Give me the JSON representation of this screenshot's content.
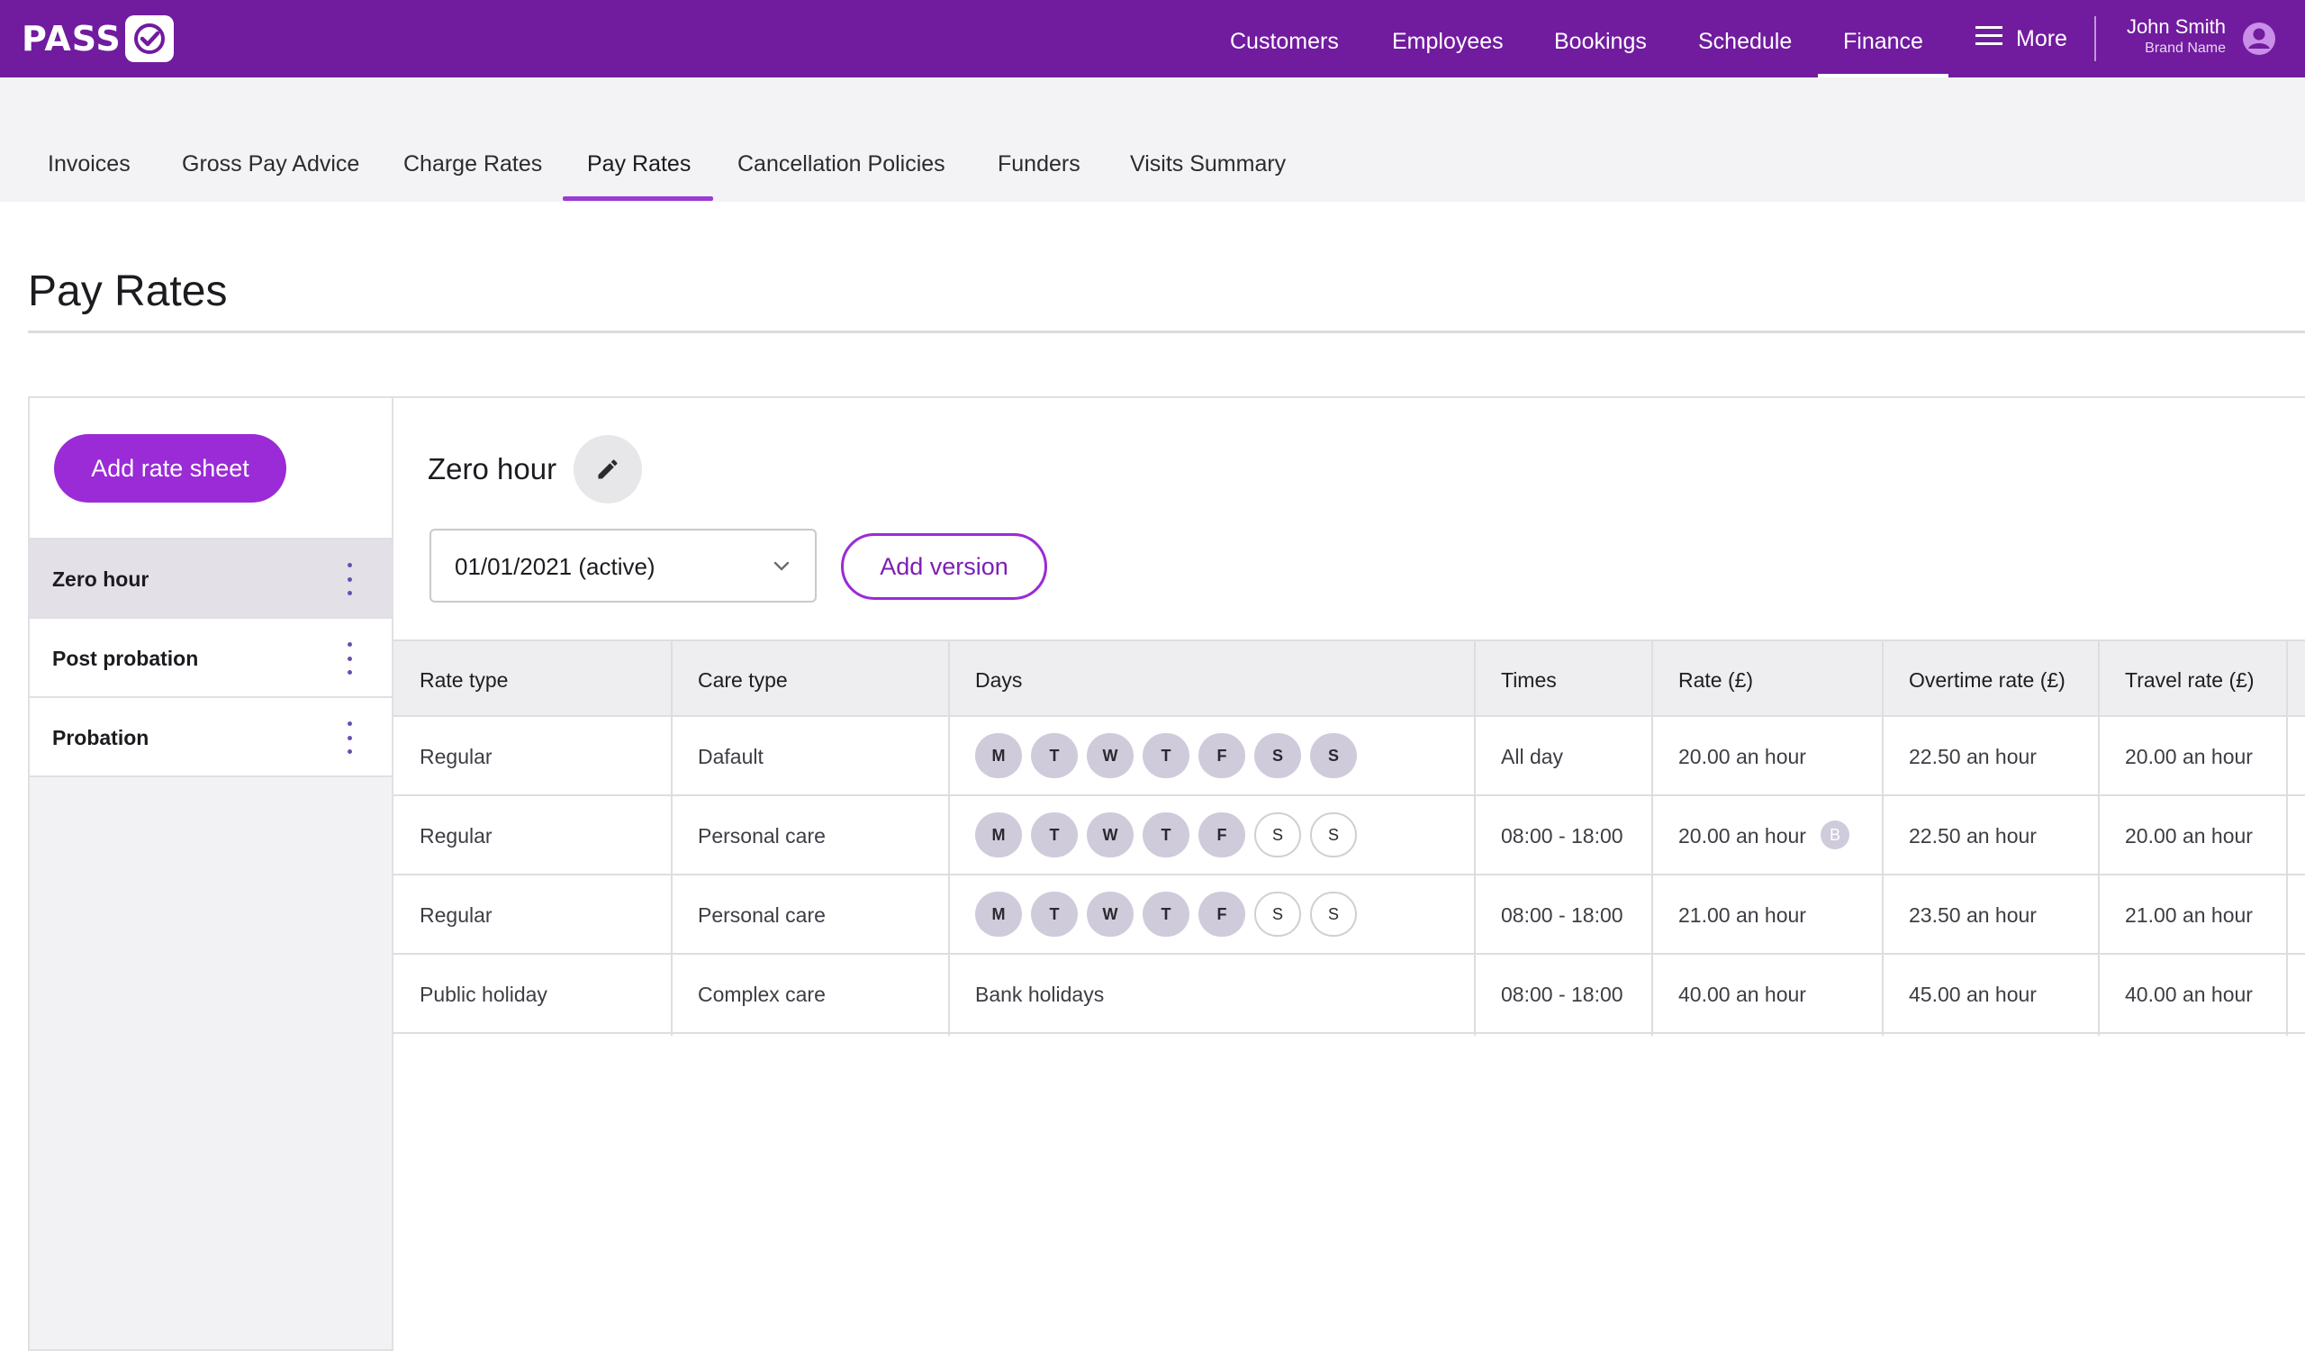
{
  "brand": {
    "logo_text": "PASS",
    "topbar_color": "#711b9f",
    "accent": "#9a2bd6"
  },
  "nav": {
    "items": [
      {
        "label": "Customers"
      },
      {
        "label": "Employees"
      },
      {
        "label": "Bookings"
      },
      {
        "label": "Schedule"
      },
      {
        "label": "Finance",
        "active": true
      }
    ],
    "more_label": "More"
  },
  "user": {
    "name": "John Smith",
    "brand": "Brand Name",
    "icon": "account-circle-icon"
  },
  "subtabs": [
    {
      "label": "Invoices"
    },
    {
      "label": "Gross Pay Advice"
    },
    {
      "label": "Charge Rates"
    },
    {
      "label": "Pay Rates",
      "active": true
    },
    {
      "label": "Cancellation Policies"
    },
    {
      "label": "Funders"
    },
    {
      "label": "Visits Summary"
    }
  ],
  "page": {
    "title": "Pay Rates"
  },
  "sidebar": {
    "add_button": "Add rate sheet",
    "sheets": [
      {
        "label": "Zero hour",
        "active": true
      },
      {
        "label": "Post probation"
      },
      {
        "label": "Probation"
      }
    ]
  },
  "sheet": {
    "title": "Zero hour",
    "version_value": "01/01/2021 (active)",
    "add_version": "Add version"
  },
  "table": {
    "headers": [
      "Rate type",
      "Care type",
      "Days",
      "Times",
      "Rate (£)",
      "Overtime rate (£)",
      "Travel rate (£)"
    ],
    "rows": [
      {
        "rate_type": "Regular",
        "care_type": "Dafault",
        "days": [
          "M",
          "T",
          "W",
          "T",
          "F",
          "S",
          "S"
        ],
        "days_on": [
          true,
          true,
          true,
          true,
          true,
          true,
          true
        ],
        "days_text": "",
        "times": "All day",
        "rate": "20.00 an hour",
        "rate_badge": "",
        "overtime": "22.50 an hour",
        "travel": "20.00 an hour"
      },
      {
        "rate_type": "Regular",
        "care_type": "Personal care",
        "days": [
          "M",
          "T",
          "W",
          "T",
          "F",
          "S",
          "S"
        ],
        "days_on": [
          true,
          true,
          true,
          true,
          true,
          false,
          false
        ],
        "days_text": "",
        "times": "08:00 - 18:00",
        "rate": "20.00 an hour",
        "rate_badge": "B",
        "overtime": "22.50 an hour",
        "travel": "20.00 an hour"
      },
      {
        "rate_type": "Regular",
        "care_type": "Personal care",
        "days": [
          "M",
          "T",
          "W",
          "T",
          "F",
          "S",
          "S"
        ],
        "days_on": [
          true,
          true,
          true,
          true,
          true,
          false,
          false
        ],
        "days_text": "",
        "times": "08:00 - 18:00",
        "rate": "21.00 an hour",
        "rate_badge": "",
        "overtime": "23.50 an hour",
        "travel": "21.00 an hour"
      },
      {
        "rate_type": "Public holiday",
        "care_type": "Complex care",
        "days": [],
        "days_on": [],
        "days_text": "Bank holidays",
        "times": "08:00 - 18:00",
        "rate": "40.00 an hour",
        "rate_badge": "",
        "overtime": "45.00 an hour",
        "travel": "40.00 an hour"
      }
    ]
  }
}
